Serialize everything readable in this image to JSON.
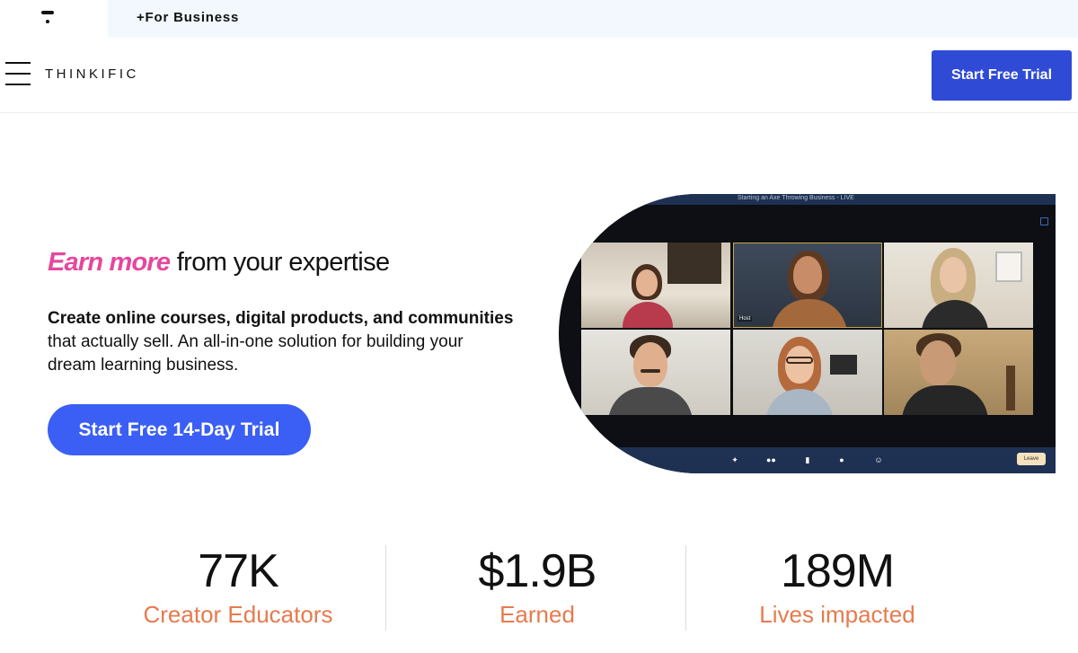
{
  "topbar": {
    "business_link": "+For Business"
  },
  "header": {
    "logo": "THINKIFIC",
    "cta": "Start Free Trial"
  },
  "hero": {
    "title_accent": "Earn more",
    "title_rest": " from your expertise",
    "sub_bold_1": "Create online courses, digital products, and communities",
    "sub_rest": " that actually sell. An all-in-one solution for building your dream learning business.",
    "cta": "Start Free 14-Day Trial"
  },
  "video": {
    "session_title": "Starting an Axe Throwing Business - LIVE",
    "host_label": "Host",
    "leave_label": "Leave",
    "control_icons": [
      "share-icon",
      "participants-icon",
      "chat-icon",
      "record-icon",
      "reactions-icon"
    ]
  },
  "stats": [
    {
      "value": "77K",
      "label": "Creator Educators"
    },
    {
      "value": "$1.9B",
      "label": "Earned"
    },
    {
      "value": "189M",
      "label": "Lives impacted"
    }
  ],
  "colors": {
    "accent_pink": "#e6479d",
    "primary_blue": "#2f4bd6",
    "hero_blue": "#3b5ff4",
    "stat_orange": "#e77a4e",
    "business_bg": "#f2f8fd"
  }
}
